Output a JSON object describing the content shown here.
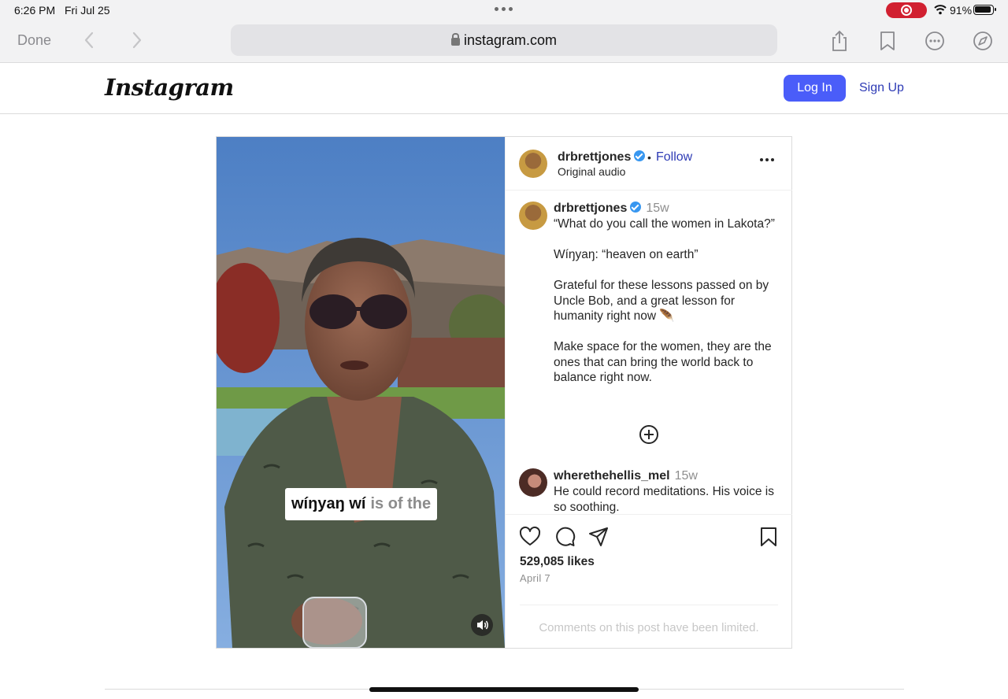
{
  "status_bar": {
    "time": "6:26 PM",
    "date": "Fri Jul 25",
    "battery": "91%"
  },
  "browser": {
    "done_label": "Done",
    "url": "instagram.com",
    "icons": [
      "back-icon",
      "forward-icon",
      "share-icon",
      "bookmark-icon",
      "more-icon",
      "compass-icon"
    ]
  },
  "header": {
    "logo": "Instagram",
    "login_label": "Log In",
    "signup_label": "Sign Up",
    "login_color": "#4a5df9"
  },
  "post": {
    "author": "drbrettjones",
    "separator": "•",
    "follow_label": "Follow",
    "audio": "Original audio",
    "caption": {
      "author": "drbrettjones",
      "time": "15w",
      "paragraphs": [
        "“What do you call the women in Lakota?”",
        "Wíŋyaŋ: “heaven on earth”",
        "Grateful for these lessons passed on by Uncle Bob, and a great lesson for humanity right now 🪶",
        "Make space for the women, they are the ones that can bring the world back to balance right now."
      ]
    },
    "comment": {
      "author": "wherethehellis_mel",
      "time": "15w",
      "text": "He could record meditations. His voice is so soothing."
    },
    "video_caption": {
      "highlighted": "wíŋyaŋ  wí",
      "rest": "is of the"
    },
    "likes": "529,085 likes",
    "date": "April 7",
    "comments_limited": "Comments on this post have been limited."
  }
}
